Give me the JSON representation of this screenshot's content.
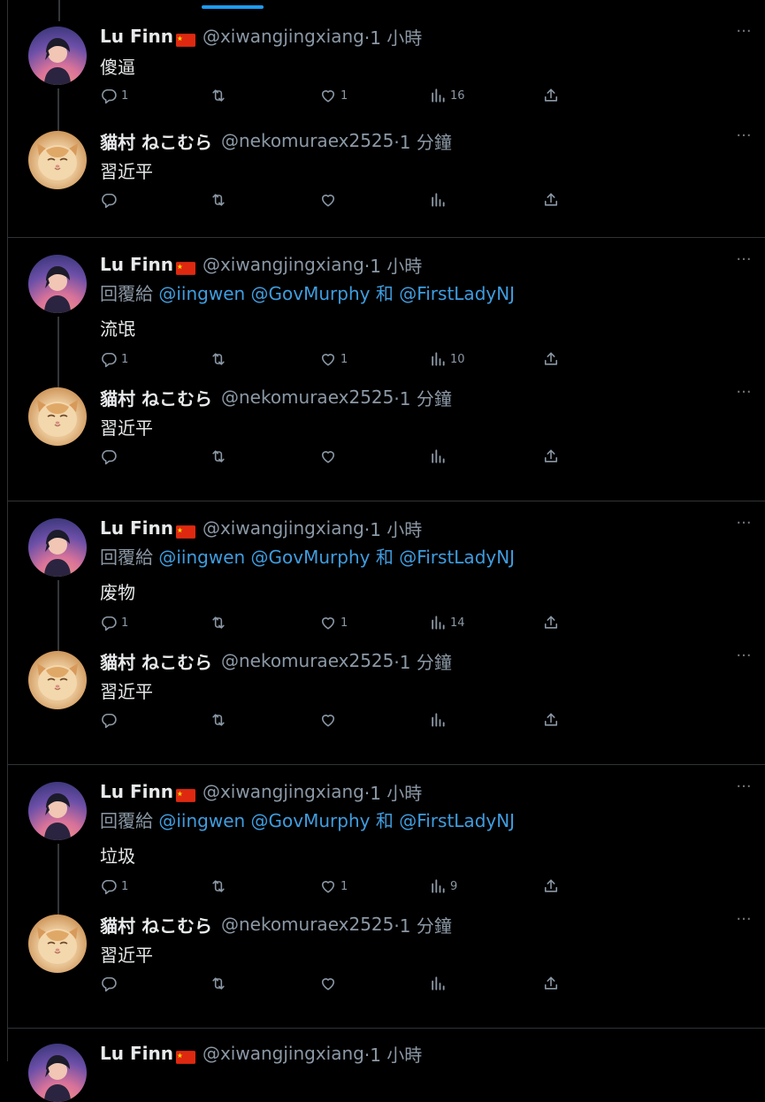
{
  "groups": [
    {
      "parent": {
        "name": "Lu Finn",
        "handle": "@xiwangjingxiang",
        "time": "·1 小時",
        "reply_prefix": "",
        "mentions": [],
        "reply_and": "",
        "text": "傻逼",
        "replies": "1",
        "retweets": "",
        "likes": "1",
        "views": "16"
      },
      "child": {
        "name": "貓村 ねこむら",
        "handle": "@nekomuraex2525",
        "time": "·1 分鐘",
        "text": "習近平"
      }
    },
    {
      "parent": {
        "name": "Lu Finn",
        "handle": "@xiwangjingxiang",
        "time": "·1 小時",
        "reply_prefix": "回覆給",
        "mentions": [
          "@iingwen",
          "@GovMurphy",
          "@FirstLadyNJ"
        ],
        "reply_and": "和",
        "text": "流氓",
        "replies": "1",
        "retweets": "",
        "likes": "1",
        "views": "10"
      },
      "child": {
        "name": "貓村 ねこむら",
        "handle": "@nekomuraex2525",
        "time": "·1 分鐘",
        "text": "習近平"
      }
    },
    {
      "parent": {
        "name": "Lu Finn",
        "handle": "@xiwangjingxiang",
        "time": "·1 小時",
        "reply_prefix": "回覆給",
        "mentions": [
          "@iingwen",
          "@GovMurphy",
          "@FirstLadyNJ"
        ],
        "reply_and": "和",
        "text": "废物",
        "replies": "1",
        "retweets": "",
        "likes": "1",
        "views": "14"
      },
      "child": {
        "name": "貓村 ねこむら",
        "handle": "@nekomuraex2525",
        "time": "·1 分鐘",
        "text": "習近平"
      }
    },
    {
      "parent": {
        "name": "Lu Finn",
        "handle": "@xiwangjingxiang",
        "time": "·1 小時",
        "reply_prefix": "回覆給",
        "mentions": [
          "@iingwen",
          "@GovMurphy",
          "@FirstLadyNJ"
        ],
        "reply_and": "和",
        "text": "垃圾",
        "replies": "1",
        "retweets": "",
        "likes": "1",
        "views": "9"
      },
      "child": {
        "name": "貓村 ねこむら",
        "handle": "@nekomuraex2525",
        "time": "·1 分鐘",
        "text": "習近平"
      }
    }
  ],
  "partial": {
    "name": "Lu Finn",
    "handle": "@xiwangjingxiang",
    "time": "·1 小時"
  },
  "more_glyph": "···",
  "colors": {
    "background": "#000000",
    "link": "#3f9ddf",
    "muted": "#8b98a5",
    "divider": "#2f3336",
    "accent": "#1d9bf0"
  },
  "icons": [
    "reply-icon",
    "retweet-icon",
    "like-icon",
    "views-icon",
    "share-icon",
    "more-icon",
    "flag-icon"
  ]
}
